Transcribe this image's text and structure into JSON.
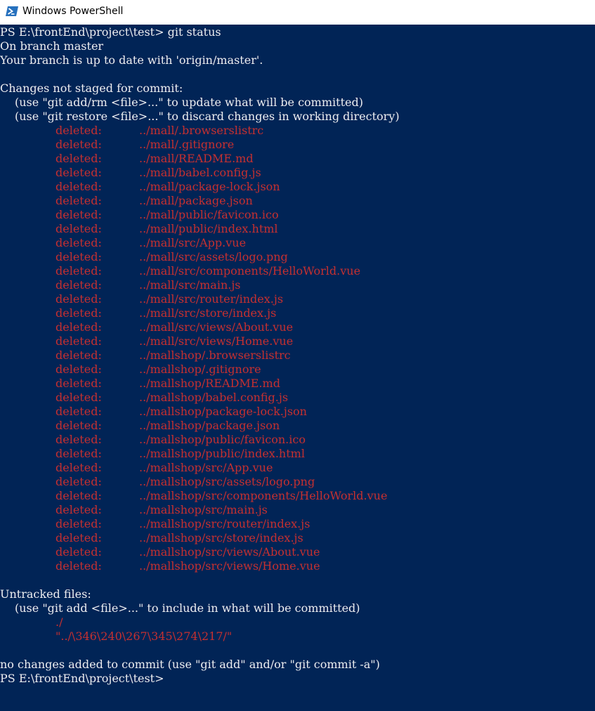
{
  "window": {
    "title": "Windows PowerShell",
    "icon": "powershell-icon"
  },
  "colors": {
    "console_bg": "#012456",
    "text": "#eeedf0",
    "error_red": "#c63030",
    "titlebar_bg": "#ffffff"
  },
  "terminal": {
    "prompt_line": "PS E:\\frontEnd\\project\\test> git status",
    "branch_line": "On branch master",
    "uptodate_line": "Your branch is up to date with 'origin/master'.",
    "changes_header": "Changes not staged for commit:",
    "hint_update": "(use \"git add/rm <file>...\" to update what will be committed)",
    "hint_restore": "(use \"git restore <file>...\" to discard changes in working directory)",
    "deleted_label": "deleted:",
    "deleted_files": [
      "../mall/.browserslistrc",
      "../mall/.gitignore",
      "../mall/README.md",
      "../mall/babel.config.js",
      "../mall/package-lock.json",
      "../mall/package.json",
      "../mall/public/favicon.ico",
      "../mall/public/index.html",
      "../mall/src/App.vue",
      "../mall/src/assets/logo.png",
      "../mall/src/components/HelloWorld.vue",
      "../mall/src/main.js",
      "../mall/src/router/index.js",
      "../mall/src/store/index.js",
      "../mall/src/views/About.vue",
      "../mall/src/views/Home.vue",
      "../mallshop/.browserslistrc",
      "../mallshop/.gitignore",
      "../mallshop/README.md",
      "../mallshop/babel.config.js",
      "../mallshop/package-lock.json",
      "../mallshop/package.json",
      "../mallshop/public/favicon.ico",
      "../mallshop/public/index.html",
      "../mallshop/src/App.vue",
      "../mallshop/src/assets/logo.png",
      "../mallshop/src/components/HelloWorld.vue",
      "../mallshop/src/main.js",
      "../mallshop/src/router/index.js",
      "../mallshop/src/store/index.js",
      "../mallshop/src/views/About.vue",
      "../mallshop/src/views/Home.vue"
    ],
    "untracked_header": "Untracked files:",
    "hint_untracked": "(use \"git add <file>...\" to include in what will be committed)",
    "untracked_files": [
      "./",
      "\"../\\346\\240\\267\\345\\274\\217/\""
    ],
    "summary_line": "no changes added to commit (use \"git add\" and/or \"git commit -a\")",
    "final_prompt": "PS E:\\frontEnd\\project\\test>"
  }
}
